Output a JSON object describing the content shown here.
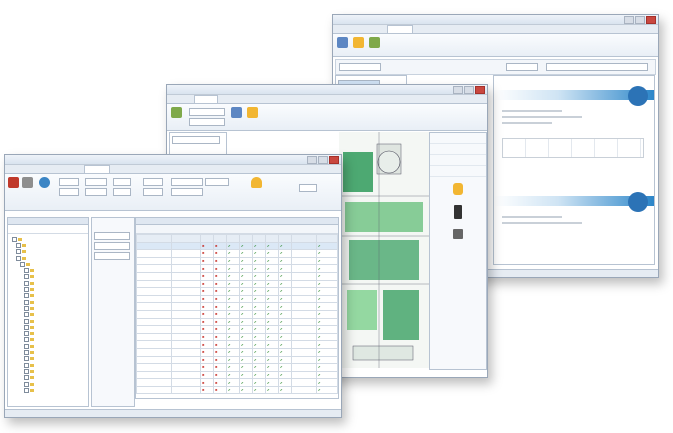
{
  "back_window": {
    "title": "",
    "tabs": [
      "",
      "",
      "",
      "",
      ""
    ],
    "status": ""
  },
  "middle_window": {
    "title": "",
    "tabs": [
      "",
      "",
      "",
      "",
      "",
      ""
    ],
    "side_panel_items": [
      "",
      "",
      "",
      "",
      "",
      "",
      "",
      "",
      "",
      ""
    ]
  },
  "front_window": {
    "title": "",
    "tabs": [
      "",
      "",
      "",
      "",
      "",
      "",
      "",
      "",
      ""
    ],
    "ribbon_buttons": [
      "",
      "",
      "",
      "",
      "",
      ""
    ],
    "tree_items": [
      "",
      "",
      "",
      "",
      "",
      "",
      "",
      "",
      "",
      "",
      "",
      "",
      "",
      "",
      "",
      "",
      "",
      "",
      "",
      "",
      "",
      "",
      "",
      "",
      "",
      "",
      "",
      "",
      ""
    ],
    "grid_rows": 20,
    "status": ""
  },
  "colors": {
    "accent_blue": "#2c86c9",
    "ok_green": "#2d8a2d",
    "denied_red": "#c8322b",
    "ribbon_bg": "#e9eff6"
  },
  "icons": {
    "check": "✔",
    "cross": "✖"
  }
}
